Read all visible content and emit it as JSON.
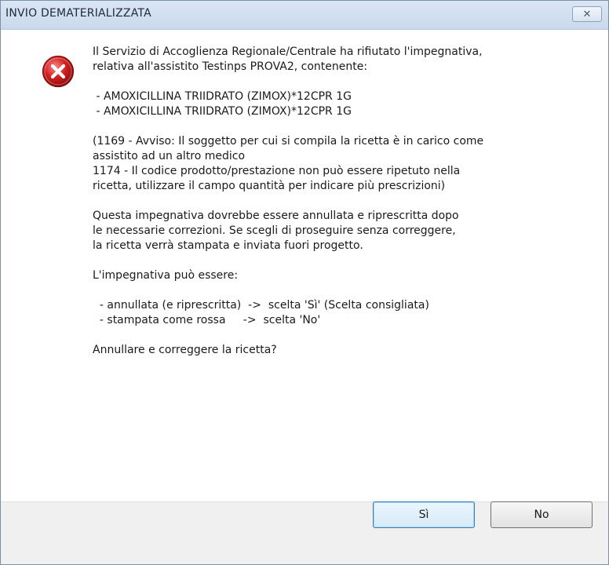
{
  "dialog": {
    "title": "INVIO DEMATERIALIZZATA",
    "close_glyph": "✕",
    "icon": "error-icon",
    "message_lines": [
      "Il Servizio di Accoglienza Regionale/Centrale ha rifiutato l'impegnativa,",
      "relativa all'assistito Testinps PROVA2, contenente:",
      "",
      " - AMOXICILLINA TRIIDRATO (ZIMOX)*12CPR 1G",
      " - AMOXICILLINA TRIIDRATO (ZIMOX)*12CPR 1G",
      "",
      "(1169 - Avviso: Il soggetto per cui si compila la ricetta è in carico come",
      "assistito ad un altro medico",
      "1174 - Il codice prodotto/prestazione non può essere ripetuto nella",
      "ricetta, utilizzare il campo quantità per indicare più prescrizioni)",
      "",
      "Questa impegnativa dovrebbe essere annullata e riprescritta dopo",
      "le necessarie correzioni. Se scegli di proseguire senza correggere,",
      "la ricetta verrà stampata e inviata fuori progetto.",
      "",
      "L'impegnativa può essere:",
      "",
      "  - annullata (e riprescritta)  ->  scelta 'Sì' (Scelta consigliata)",
      "  - stampata come rossa     ->  scelta 'No'",
      "",
      "Annullare e correggere la ricetta?"
    ],
    "buttons": {
      "yes_label": "Sì",
      "no_label": "No"
    }
  },
  "colors": {
    "titlebar": "#c9d9ec",
    "error_red": "#d11f1f",
    "footer": "#f0f0f0"
  }
}
